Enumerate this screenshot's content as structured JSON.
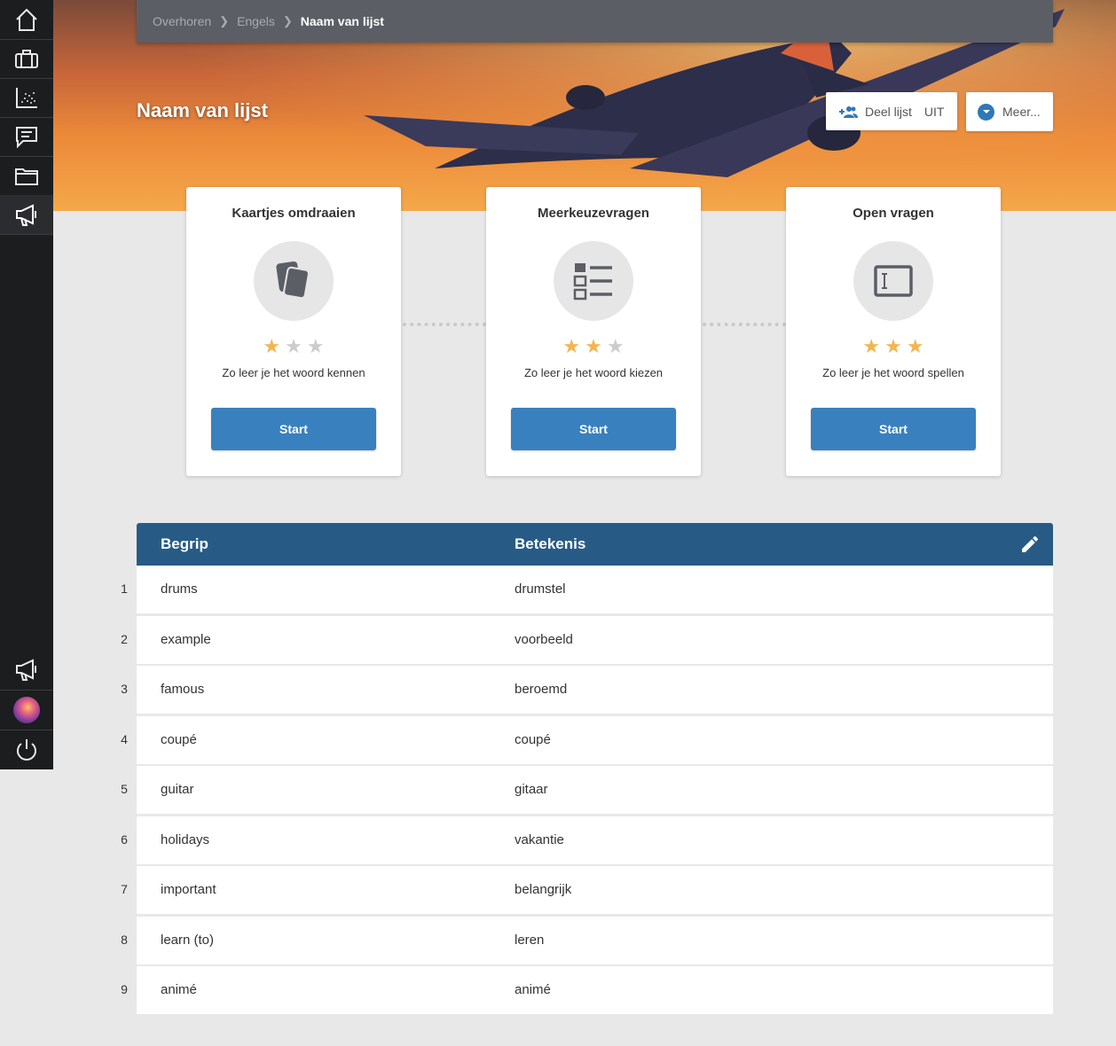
{
  "breadcrumb": {
    "items": [
      "Overhoren",
      "Engels",
      "Naam van lijst"
    ]
  },
  "header": {
    "title": "Naam van lijst",
    "share_label": "Deel lijst",
    "share_state": "UIT",
    "more_label": "Meer..."
  },
  "colors": {
    "accent": "#3980bf",
    "table_header": "#275b85",
    "star_on": "#f5b54e",
    "star_off": "#cccccc"
  },
  "cards": [
    {
      "title": "Kaartjes omdraaien",
      "stars": 1,
      "max_stars": 3,
      "desc": "Zo leer je het woord kennen",
      "button": "Start",
      "icon": "cards-icon"
    },
    {
      "title": "Meerkeuzevragen",
      "stars": 2,
      "max_stars": 3,
      "desc": "Zo leer je het woord kiezen",
      "button": "Start",
      "icon": "list-icon"
    },
    {
      "title": "Open vragen",
      "stars": 3,
      "max_stars": 3,
      "desc": "Zo leer je het woord spellen",
      "button": "Start",
      "icon": "text-input-icon"
    }
  ],
  "table": {
    "headers": [
      "Begrip",
      "Betekenis"
    ],
    "rows": [
      {
        "num": "1",
        "term": "drums",
        "meaning": "drumstel"
      },
      {
        "num": "2",
        "term": "example",
        "meaning": "voorbeeld"
      },
      {
        "num": "3",
        "term": "famous",
        "meaning": "beroemd"
      },
      {
        "num": "4",
        "term": "coupé",
        "meaning": "coupé"
      },
      {
        "num": "5",
        "term": "guitar",
        "meaning": "gitaar"
      },
      {
        "num": "6",
        "term": "holidays",
        "meaning": "vakantie"
      },
      {
        "num": "7",
        "term": "important",
        "meaning": "belangrijk"
      },
      {
        "num": "8",
        "term": "learn (to)",
        "meaning": "leren"
      },
      {
        "num": "9",
        "term": "animé",
        "meaning": "animé"
      }
    ]
  }
}
